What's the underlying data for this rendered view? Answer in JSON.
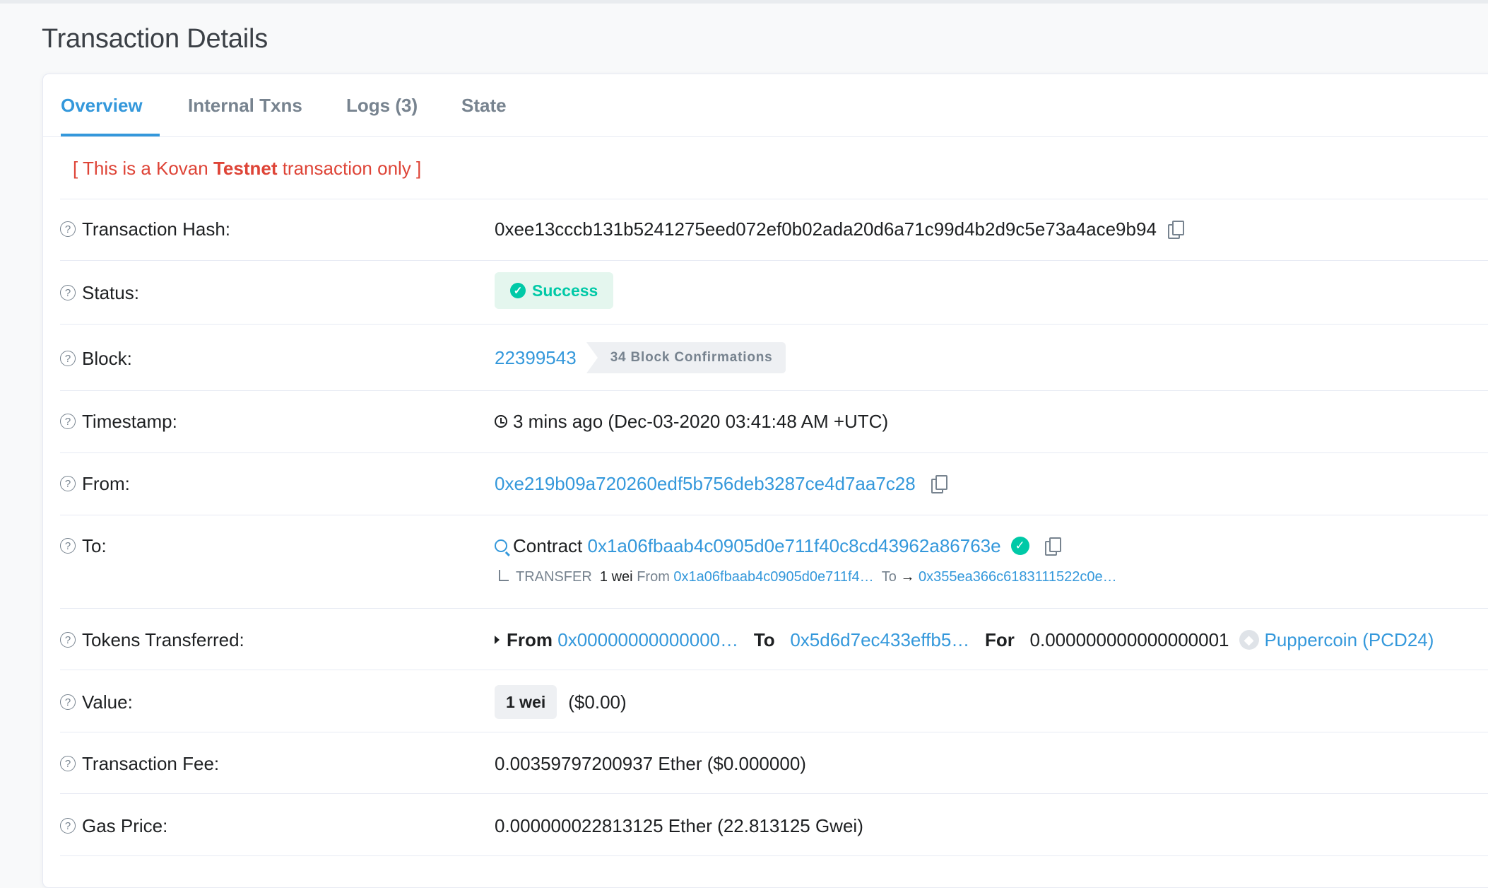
{
  "page": {
    "title": "Transaction Details"
  },
  "tabs": [
    {
      "label": "Overview",
      "active": true
    },
    {
      "label": "Internal Txns",
      "active": false
    },
    {
      "label": "Logs (3)",
      "active": false
    },
    {
      "label": "State",
      "active": false
    }
  ],
  "notice": {
    "prefix": "[ This is a Kovan ",
    "bold": "Testnet",
    "suffix": " transaction only ]"
  },
  "rows": {
    "hash": {
      "label": "Transaction Hash:",
      "value": "0xee13cccb131b5241275eed072ef0b02ada20d6a71c99d4b2d9c5e73a4ace9b94"
    },
    "status": {
      "label": "Status:",
      "value": "Success"
    },
    "block": {
      "label": "Block:",
      "number": "22399543",
      "confirmations": "34 Block Confirmations"
    },
    "timestamp": {
      "label": "Timestamp:",
      "value": "3 mins ago (Dec-03-2020 03:41:48 AM +UTC)"
    },
    "from": {
      "label": "From:",
      "address": "0xe219b09a720260edf5b756deb3287ce4d7aa7c28"
    },
    "to": {
      "label": "To:",
      "prefix": "Contract",
      "address": "0x1a06fbaab4c0905d0e711f40c8cd43962a86763e",
      "transfer": {
        "type": "TRANSFER",
        "amount": "1 wei",
        "from_label": "From",
        "from_address": "0x1a06fbaab4c0905d0e711f4…",
        "to_label": "To",
        "arrow": "→",
        "to_address": "0x355ea366c6183111522c0e…"
      }
    },
    "tokens": {
      "label": "Tokens Transferred:",
      "from_label": "From",
      "from_address": "0x00000000000000…",
      "to_label": "To",
      "to_address": "0x5d6d7ec433effb5…",
      "for_label": "For",
      "amount": "0.000000000000000001",
      "token_name": "Puppercoin (PCD24)"
    },
    "value": {
      "label": "Value:",
      "amount": "1 wei",
      "usd": "($0.00)"
    },
    "fee": {
      "label": "Transaction Fee:",
      "value": "0.00359797200937 Ether ($0.000000)"
    },
    "gas": {
      "label": "Gas Price:",
      "value": "0.000000022813125 Ether (22.813125 Gwei)"
    }
  },
  "colors": {
    "link": "#3498db",
    "success": "#00c9a7",
    "danger": "#de4437",
    "muted": "#77838f"
  }
}
